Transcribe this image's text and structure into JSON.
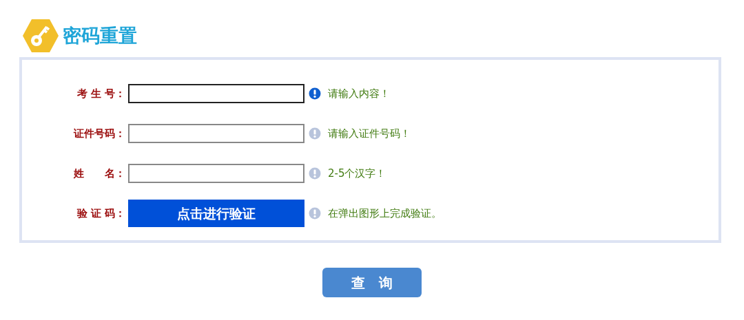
{
  "title": "密码重置",
  "fields": [
    {
      "kind": "input",
      "label": "考 生 号：",
      "focused": true,
      "hint": "请输入内容！",
      "hint_active": true
    },
    {
      "kind": "input",
      "label": "证件号码：",
      "focused": false,
      "hint": "请输入证件号码！",
      "hint_active": false
    },
    {
      "kind": "input",
      "label": "姓　　名：",
      "focused": false,
      "hint": "2-5个汉字！",
      "hint_active": false
    },
    {
      "kind": "verify",
      "label": "验 证 码：",
      "button": "点击进行验证",
      "hint": "在弹出图形上完成验证。",
      "hint_active": false
    }
  ],
  "submit": "查　询"
}
